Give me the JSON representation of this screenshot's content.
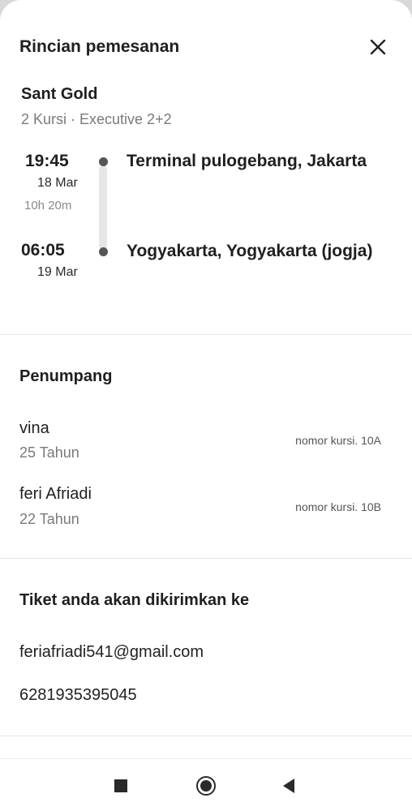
{
  "header": {
    "title": "Rincian pemesanan"
  },
  "bus": {
    "name": "Sant Gold",
    "details": "2 Kursi · Executive 2+2"
  },
  "trip": {
    "departure": {
      "time": "19:45",
      "date": "18 Mar",
      "place": "Terminal pulogebang, Jakarta"
    },
    "duration": "10h 20m",
    "arrival": {
      "time": "06:05",
      "date": "19 Mar",
      "place": "Yogyakarta, Yogyakarta (jogja)"
    }
  },
  "passengers": {
    "title": "Penumpang",
    "items": [
      {
        "name": "vina",
        "age": "25 Tahun",
        "seat": "nomor kursi. 10A"
      },
      {
        "name": "feri Afriadi",
        "age": "22 Tahun",
        "seat": "nomor kursi. 10B"
      }
    ]
  },
  "ticket": {
    "title": "Tiket anda akan dikirimkan ke",
    "email": "feriafriadi541@gmail.com",
    "phone": "6281935395045"
  },
  "icons": {
    "close": "close-icon",
    "nav_recent": "square-icon",
    "nav_home": "circle-icon",
    "nav_back": "triangle-back-icon"
  }
}
